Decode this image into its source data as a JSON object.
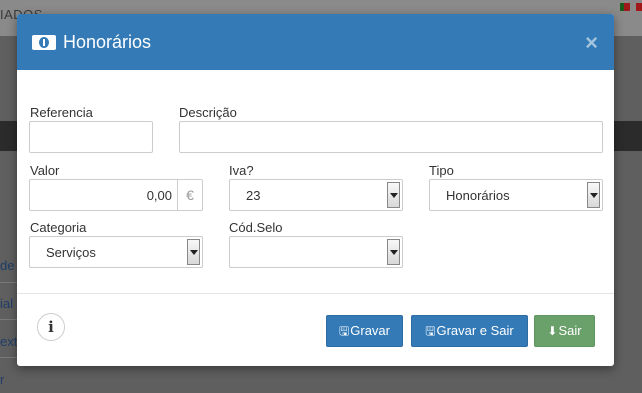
{
  "background": {
    "top_text": "IADOS",
    "side_items": [
      "de",
      "ial",
      "ext",
      "r"
    ]
  },
  "modal": {
    "title": "Honorários",
    "close": "×",
    "fields": {
      "referencia": {
        "label": "Referencia",
        "value": ""
      },
      "descricao": {
        "label": "Descrição",
        "value": ""
      },
      "valor": {
        "label": "Valor",
        "value": "0,00",
        "currency": "€"
      },
      "iva": {
        "label": "Iva?",
        "value": "23"
      },
      "tipo": {
        "label": "Tipo",
        "value": "Honorários"
      },
      "categoria": {
        "label": "Categoria",
        "value": "Serviços"
      },
      "cod_selo": {
        "label": "Cód.Selo",
        "value": ""
      }
    },
    "footer": {
      "info": "i",
      "gravar": "Gravar",
      "gravar_sair": "Gravar e Sair",
      "sair": "Sair"
    }
  },
  "colors": {
    "header": "#337ab7",
    "primary_button": "#337ab7",
    "exit_button": "#6aa06a"
  }
}
